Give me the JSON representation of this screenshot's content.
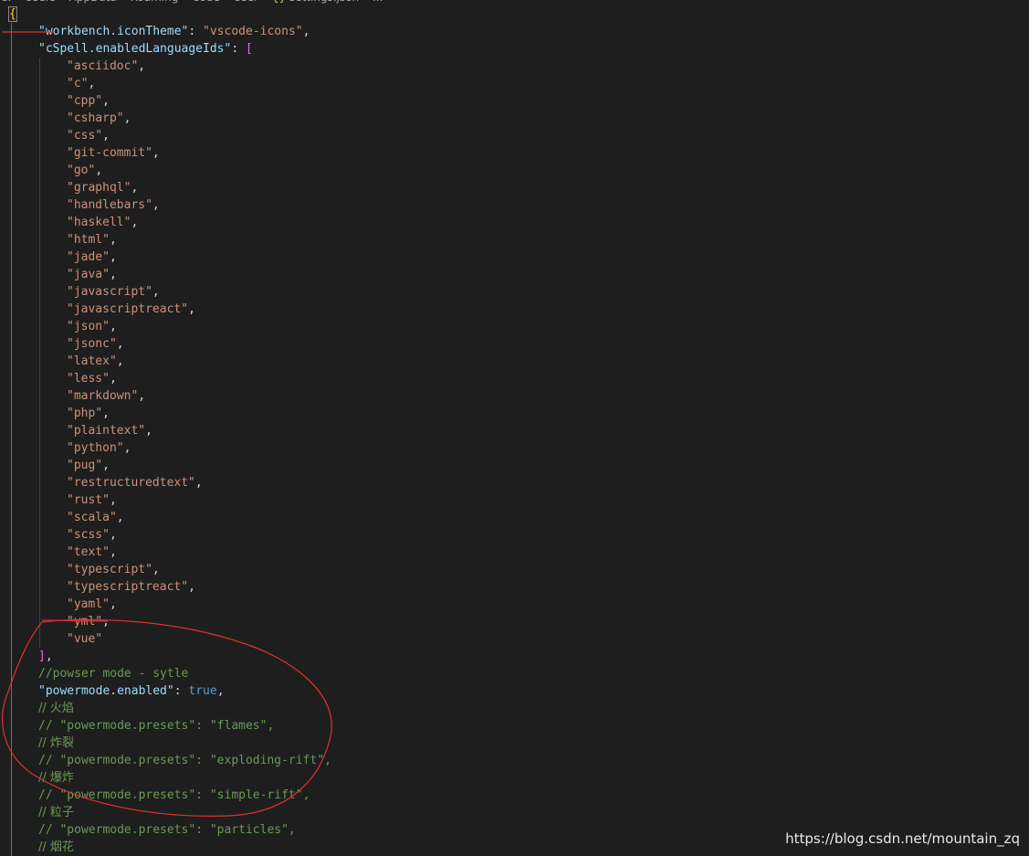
{
  "breadcrumb": {
    "items": [
      "C:",
      "Users",
      "AppData",
      "Roaming",
      "Code",
      "User",
      "settings.json",
      "..."
    ],
    "file_icon": "{}"
  },
  "editor": {
    "open_brace": "{",
    "icon_theme_key": "\"workbench.iconTheme\"",
    "icon_theme_value": "\"vscode-icons\"",
    "cspell_key": "\"cSpell.enabledLanguageIds\"",
    "open_bracket": "[",
    "languages": [
      "\"asciidoc\"",
      "\"c\"",
      "\"cpp\"",
      "\"csharp\"",
      "\"css\"",
      "\"git-commit\"",
      "\"go\"",
      "\"graphql\"",
      "\"handlebars\"",
      "\"haskell\"",
      "\"html\"",
      "\"jade\"",
      "\"java\"",
      "\"javascript\"",
      "\"javascriptreact\"",
      "\"json\"",
      "\"jsonc\"",
      "\"latex\"",
      "\"less\"",
      "\"markdown\"",
      "\"php\"",
      "\"plaintext\"",
      "\"python\"",
      "\"pug\"",
      "\"restructuredtext\"",
      "\"rust\"",
      "\"scala\"",
      "\"scss\"",
      "\"text\"",
      "\"typescript\"",
      "\"typescriptreact\"",
      "\"yaml\"",
      "\"yml\"",
      "\"vue\""
    ],
    "close_bracket": "]",
    "comment_powermode": "//powser mode - sytle",
    "powermode_key": "\"powermode.enabled\"",
    "powermode_value": "true",
    "comments": [
      "// 火焰",
      "// \"powermode.presets\": \"flames\",",
      "// 炸裂",
      "// \"powermode.presets\": \"exploding-rift\",",
      "// 爆炸",
      "// \"powermode.presets\": \"simple-rift\",",
      "// 粒子",
      "// \"powermode.presets\": \"particles\",",
      "// 烟花"
    ]
  },
  "watermark": "https://blog.csdn.net/mountain_zq",
  "colors": {
    "background": "#1e1e1e",
    "key": "#9cdcfe",
    "string": "#ce9178",
    "boolean": "#569cd6",
    "comment": "#6a9955",
    "annotation": "#e03030"
  }
}
